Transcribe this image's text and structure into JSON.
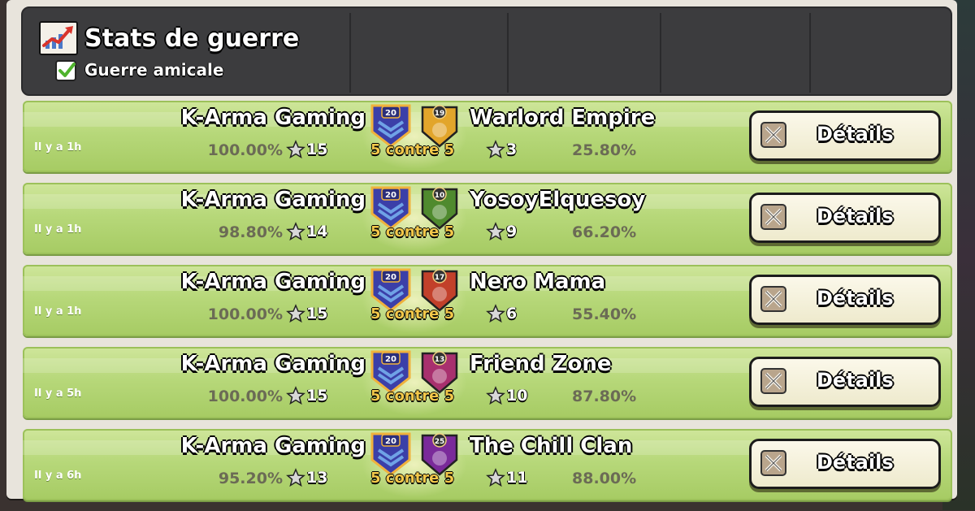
{
  "header": {
    "title": "Stats de guerre",
    "subtitle": "Guerre amicale",
    "title_icon": "chart-up-icon",
    "checkbox_checked": true
  },
  "colors": {
    "row_green": "#b7d87a",
    "versus_gold": "#f3c84a",
    "header_bg": "#3c3c3e"
  },
  "wars": [
    {
      "time": "Il y a 1h",
      "clan": "K-Arma Gaming",
      "clan_level": "20",
      "clan_pct": "100.00%",
      "clan_stars": "15",
      "versus": "5 contre 5",
      "opp_level": "19",
      "opp": "Warlord Empire",
      "opp_stars": "3",
      "opp_pct": "25.80%",
      "details": "Détails",
      "opp_badge_color": "#e2a52b"
    },
    {
      "time": "Il y a 1h",
      "clan": "K-Arma Gaming",
      "clan_level": "20",
      "clan_pct": "98.80%",
      "clan_stars": "14",
      "versus": "5 contre 5",
      "opp_level": "10",
      "opp": "YosoyElquesoy",
      "opp_stars": "9",
      "opp_pct": "66.20%",
      "details": "Détails",
      "opp_badge_color": "#4f8a2e"
    },
    {
      "time": "Il y a 1h",
      "clan": "K-Arma Gaming",
      "clan_level": "20",
      "clan_pct": "100.00%",
      "clan_stars": "15",
      "versus": "5 contre 5",
      "opp_level": "17",
      "opp": "Nero Mama",
      "opp_stars": "6",
      "opp_pct": "55.40%",
      "details": "Détails",
      "opp_badge_color": "#c2402a"
    },
    {
      "time": "Il y a 5h",
      "clan": "K-Arma Gaming",
      "clan_level": "20",
      "clan_pct": "100.00%",
      "clan_stars": "15",
      "versus": "5 contre 5",
      "opp_level": "13",
      "opp": "Friend Zone",
      "opp_stars": "10",
      "opp_pct": "87.80%",
      "details": "Détails",
      "opp_badge_color": "#a8306e"
    },
    {
      "time": "Il y a 6h",
      "clan": "K-Arma Gaming",
      "clan_level": "20",
      "clan_pct": "95.20%",
      "clan_stars": "13",
      "versus": "5 contre 5",
      "opp_level": "25",
      "opp": "The Chill Clan",
      "opp_stars": "11",
      "opp_pct": "88.00%",
      "details": "Détails",
      "opp_badge_color": "#7a2a9a"
    }
  ]
}
